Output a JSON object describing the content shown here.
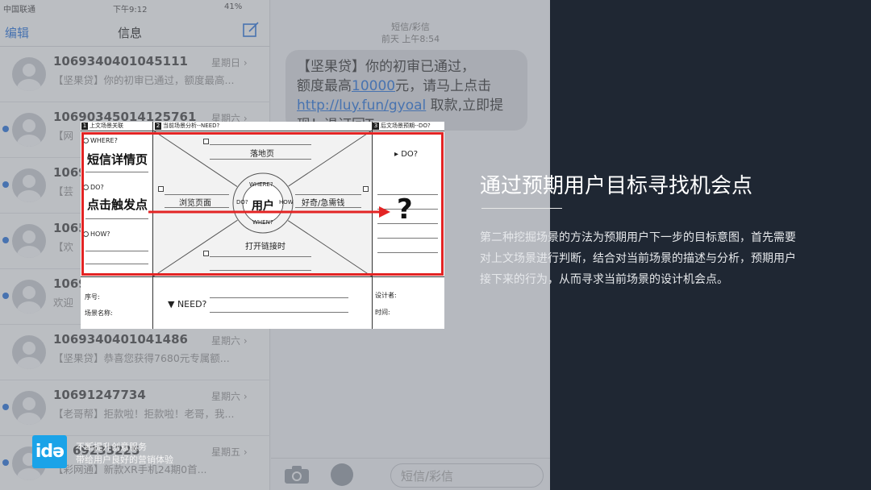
{
  "phone": {
    "status": {
      "carrier": "中国联通",
      "time": "下午9:12",
      "battery": "41%"
    },
    "nav": {
      "edit": "编辑",
      "title": "信息"
    },
    "conversations": [
      {
        "number": "1069340401045111",
        "date": "星期日",
        "preview": "【坚果贷】你的初审已通过，额度最高..."
      },
      {
        "number": "10690345014125761",
        "date": "星期六",
        "preview": "【网"
      },
      {
        "number": "1069",
        "date": "",
        "preview": "【芸"
      },
      {
        "number": "1065",
        "date": "",
        "preview": "【欢"
      },
      {
        "number": "1069",
        "date": "",
        "preview": "欢迎"
      },
      {
        "number": "1069340401041486",
        "date": "星期六",
        "preview": "【坚果贷】恭喜您获得7680元专属额..."
      },
      {
        "number": "10691247734",
        "date": "星期六",
        "preview": "【老哥帮】拒款啦！拒款啦！老哥，我..."
      },
      {
        "number": "69233225",
        "date": "星期五",
        "preview": "【彩网通】新款XR手机24期0首..."
      }
    ],
    "thread": {
      "header_type": "短信/彩信",
      "header_date": "前天 上午8:54",
      "msg_line1": "【坚果贷】你的初审已通过，",
      "msg_line2_prefix": "额度最高",
      "msg_amount": "10000",
      "msg_line2_suffix": "元，请马上点击",
      "msg_link": "http://luy.fun/gyoal",
      "msg_line3_suffix": " 取款,立即提",
      "msg_line4": "现！退订回T",
      "input_placeholder": "短信/彩信"
    }
  },
  "brand": {
    "logo_text": "idə",
    "line1": "不断提升创意服务",
    "line2": "带给用户良好的营销体验"
  },
  "card": {
    "sections": [
      {
        "num": "1",
        "title": "上文场景关联"
      },
      {
        "num": "2",
        "title": "当前场景分析--NEED?"
      },
      {
        "num": "3",
        "title": "后文场景预期--DO?"
      }
    ],
    "where_label": "WHERE?",
    "where_value": "短信详情页",
    "do_label": "DO?",
    "do_value": "点击触发点",
    "how_label": "HOW?",
    "top_label": "落地页",
    "left_label": "浏览页面",
    "right_label": "好奇/急需钱",
    "bottom_label": "打开链接时",
    "center_label": "用户",
    "ring_where": "WHERE?",
    "ring_when": "WHEN?",
    "ring_do": "DO?",
    "ring_how": "HOW",
    "right_do_label": "▸ DO?",
    "question_mark": "?",
    "footer": {
      "seq_label": "序号:",
      "scene_label": "场景名称:",
      "need_label": "▼ NEED?",
      "designer_label": "设计者:",
      "time_label": "时间:"
    }
  },
  "panel": {
    "title": "通过预期用户目标寻找机会点",
    "body": "第二种挖掘场景的方法为预期用户下一步的目标意图，首先需要对上文场景进行判断，结合对当前场景的描述与分析，预期用户接下来的行为，从而寻求当前场景的设计机会点。"
  },
  "colors": {
    "background": "#1f2733",
    "highlight": "#e32424",
    "brand": "#1aa3e8"
  }
}
